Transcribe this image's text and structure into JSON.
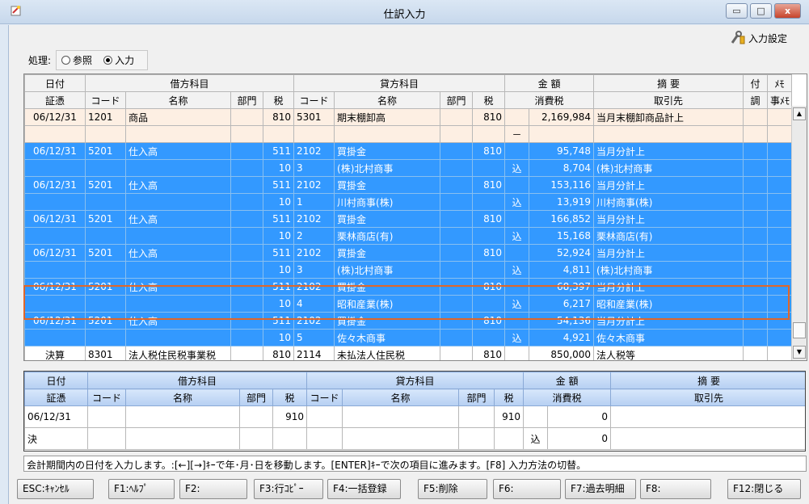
{
  "window": {
    "title": "仕訳入力",
    "minimize": "▭",
    "maximize": "□",
    "close": "x"
  },
  "toolbar": {
    "settings_label": "入力設定"
  },
  "mode": {
    "label": "処理:",
    "options": [
      {
        "label": "参照",
        "selected": false
      },
      {
        "label": "入力",
        "selected": true
      }
    ]
  },
  "grid": {
    "header1": {
      "date": "日付",
      "debit": "借方科目",
      "credit": "貸方科目",
      "amount": "金 額",
      "summary": "摘 要",
      "attach": "付",
      "memo": "ﾒﾓ"
    },
    "header2": {
      "voucher": "証憑",
      "code": "コード",
      "name": "名称",
      "dept": "部門",
      "tax": "税",
      "code2": "コード",
      "name2": "名称",
      "dept2": "部門",
      "tax2": "税",
      "ctax": "消費税",
      "partner": "取引先",
      "adj": "調",
      "memo2": "事ﾒﾓ"
    },
    "rows": [
      {
        "a": [
          "06/12/31",
          "1201",
          "商品",
          "",
          "810",
          "5301",
          "期末棚卸高",
          "",
          "810",
          "",
          "2,169,984",
          "当月末棚卸商品計上",
          "",
          ""
        ],
        "b": [
          "",
          "",
          "",
          "",
          "",
          "",
          "",
          "",
          "",
          "－",
          "",
          "",
          "",
          ""
        ],
        "style": "first"
      },
      {
        "a": [
          "06/12/31",
          "5201",
          "仕入高",
          "",
          "511",
          "2102",
          "買掛金",
          "",
          "810",
          "",
          "95,748",
          "当月分計上",
          "",
          ""
        ],
        "b": [
          "",
          "",
          "",
          "",
          "10",
          "3",
          "(株)北村商事",
          "",
          "",
          "込",
          "8,704",
          "(株)北村商事",
          "",
          ""
        ],
        "style": "sel"
      },
      {
        "a": [
          "06/12/31",
          "5201",
          "仕入高",
          "",
          "511",
          "2102",
          "買掛金",
          "",
          "810",
          "",
          "153,116",
          "当月分計上",
          "",
          ""
        ],
        "b": [
          "",
          "",
          "",
          "",
          "10",
          "1",
          "川村商事(株)",
          "",
          "",
          "込",
          "13,919",
          "川村商事(株)",
          "",
          ""
        ],
        "style": "sel"
      },
      {
        "a": [
          "06/12/31",
          "5201",
          "仕入高",
          "",
          "511",
          "2102",
          "買掛金",
          "",
          "810",
          "",
          "166,852",
          "当月分計上",
          "",
          ""
        ],
        "b": [
          "",
          "",
          "",
          "",
          "10",
          "2",
          "栗林商店(有)",
          "",
          "",
          "込",
          "15,168",
          "栗林商店(有)",
          "",
          ""
        ],
        "style": "sel"
      },
      {
        "a": [
          "06/12/31",
          "5201",
          "仕入高",
          "",
          "511",
          "2102",
          "買掛金",
          "",
          "810",
          "",
          "52,924",
          "当月分計上",
          "",
          ""
        ],
        "b": [
          "",
          "",
          "",
          "",
          "10",
          "3",
          "(株)北村商事",
          "",
          "",
          "込",
          "4,811",
          "(株)北村商事",
          "",
          ""
        ],
        "style": "sel"
      },
      {
        "a": [
          "06/12/31",
          "5201",
          "仕入高",
          "",
          "511",
          "2102",
          "買掛金",
          "",
          "810",
          "",
          "68,397",
          "当月分計上",
          "",
          ""
        ],
        "b": [
          "",
          "",
          "",
          "",
          "10",
          "4",
          "昭和産業(株)",
          "",
          "",
          "込",
          "6,217",
          "昭和産業(株)",
          "",
          ""
        ],
        "style": "sel"
      },
      {
        "a": [
          "06/12/31",
          "5201",
          "仕入高",
          "",
          "511",
          "2102",
          "買掛金",
          "",
          "810",
          "",
          "54,136",
          "当月分計上",
          "",
          ""
        ],
        "b": [
          "",
          "",
          "",
          "",
          "10",
          "5",
          "佐々木商事",
          "",
          "",
          "込",
          "4,921",
          "佐々木商事",
          "",
          ""
        ],
        "style": "sel"
      },
      {
        "a": [
          "決算",
          "8301",
          "法人税住民税事業税",
          "",
          "810",
          "2114",
          "未払法人住民税",
          "",
          "810",
          "",
          "850,000",
          "法人税等",
          "",
          ""
        ],
        "style": "white"
      }
    ]
  },
  "entry": {
    "header1": {
      "date": "日付",
      "debit": "借方科目",
      "credit": "貸方科目",
      "amount": "金 額",
      "summary": "摘 要"
    },
    "header2": {
      "voucher": "証憑",
      "code": "コード",
      "name": "名称",
      "dept": "部門",
      "tax": "税",
      "code2": "コード",
      "name2": "名称",
      "dept2": "部門",
      "tax2": "税",
      "ctax": "消費税",
      "partner": "取引先"
    },
    "row1": [
      "06/12/31",
      "",
      "",
      "",
      "910",
      "",
      "",
      "",
      "910",
      "",
      "0",
      ""
    ],
    "row2": [
      "決",
      "",
      "",
      "",
      "",
      "",
      "",
      "",
      "",
      "込",
      "0",
      ""
    ]
  },
  "status_text": "会計期間内の日付を入力します。:[←][→]ｷｰで年･月･日を移動します。[ENTER]ｷｰで次の項目に進みます。[F8] 入力方法の切替。",
  "fkeys": [
    "ESC:ｷｬﾝｾﾙ",
    "F1:ﾍﾙﾌﾟ",
    "F2:",
    "F3:行ｺﾋﾟｰ",
    "F4:一括登録",
    "F5:削除",
    "F6:",
    "F7:過去明細",
    "F8:",
    "F12:閉じる"
  ],
  "colors": {
    "selected_row": "#3399ff",
    "highlight_border": "#e0662a",
    "first_row": "#fdefe3"
  }
}
